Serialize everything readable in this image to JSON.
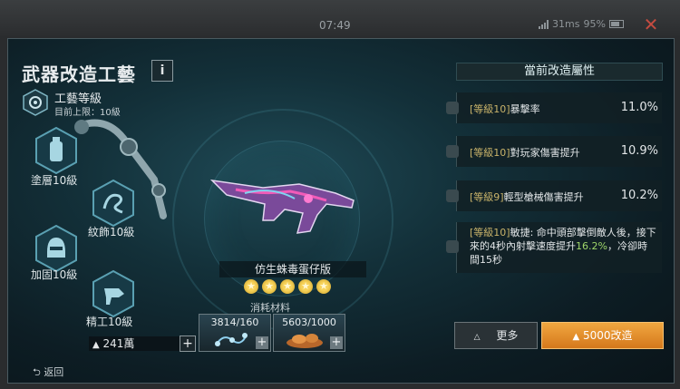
{
  "status_bar": {
    "time": "07:49",
    "ping": "31ms",
    "battery": "95%"
  },
  "header": {
    "title": "武器改造工藝",
    "info_label": "i"
  },
  "craft": {
    "label": "工藝等級",
    "cap": "目前上限：10級"
  },
  "mods": [
    {
      "name": "塗層10級",
      "icon": "spray-can-icon"
    },
    {
      "name": "紋飾10級",
      "icon": "swirl-pattern-icon"
    },
    {
      "name": "加固10級",
      "icon": "helmet-icon"
    },
    {
      "name": "精工10級",
      "icon": "drill-icon"
    }
  ],
  "weapon": {
    "name": "仿生蛛毒蛋仔版",
    "stars": 5
  },
  "materials": {
    "label": "消耗材料",
    "items": [
      {
        "count": "3814/160",
        "icon": "blueprint-icon"
      },
      {
        "count": "5603/1000",
        "icon": "parts-pile-icon"
      }
    ]
  },
  "currency": {
    "amount": "241萬",
    "plus": "+"
  },
  "back": {
    "label": "返回"
  },
  "attributes": {
    "title": "當前改造屬性",
    "rows": [
      {
        "level": "[等級10]",
        "text": "暴擊率",
        "value": "11.0%"
      },
      {
        "level": "[等級10]",
        "text": "對玩家傷害提升",
        "value": "10.9%"
      },
      {
        "level": "[等級9]",
        "text": "輕型槍械傷害提升",
        "value": "10.2%"
      },
      {
        "level": "[等級10]",
        "text": "敏捷: 命中頭部擊倒敵人後，接下來的4秒內射擊速度提升",
        "highlight": "16.2%",
        "text_tail": "，冷卻時間15秒"
      }
    ]
  },
  "buttons": {
    "more": "更多",
    "upgrade": "5000改造"
  },
  "colors": {
    "accent": "#e6902c",
    "highlight": "#9fd66a",
    "level_tag": "#c9b36a"
  }
}
